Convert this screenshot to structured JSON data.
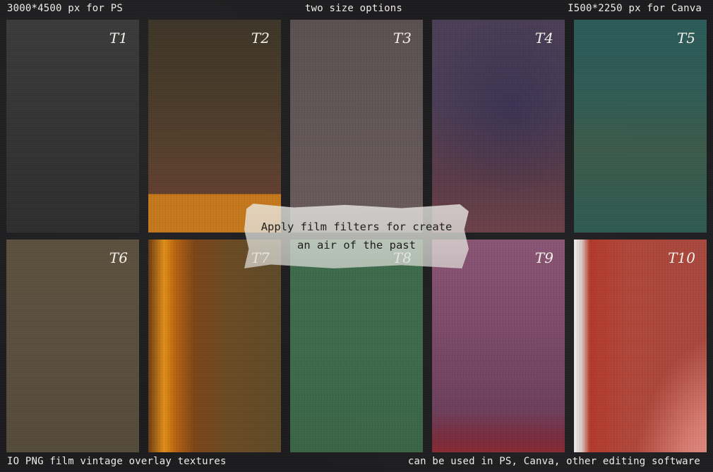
{
  "header": {
    "left": "3000*4500 px for PS",
    "center": "two size options",
    "right": "I500*2250 px for Canva"
  },
  "footer": {
    "left": "IO PNG film vintage overlay textures",
    "right": "can be used in PS, Canva, other editing software"
  },
  "tape": {
    "line1": "Apply film filters for create",
    "line2": "an air of the past"
  },
  "tiles": [
    {
      "label": "T1"
    },
    {
      "label": "T2"
    },
    {
      "label": "T3"
    },
    {
      "label": "T4"
    },
    {
      "label": "T5"
    },
    {
      "label": "T6"
    },
    {
      "label": "T7"
    },
    {
      "label": "T8"
    },
    {
      "label": "T9"
    },
    {
      "label": "T10"
    }
  ]
}
